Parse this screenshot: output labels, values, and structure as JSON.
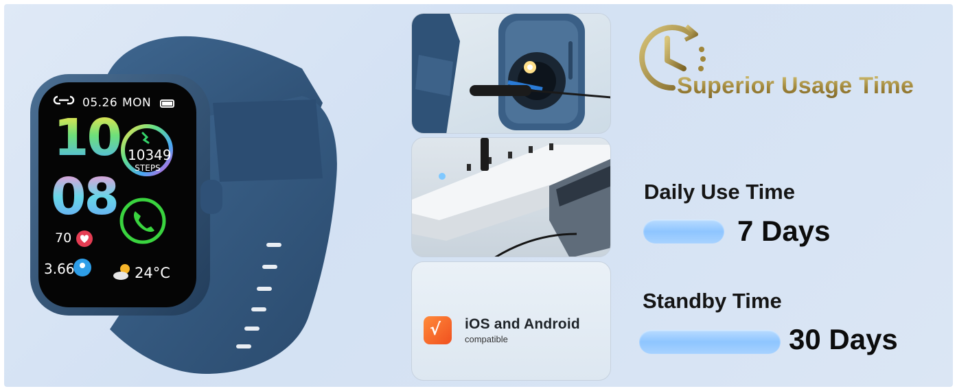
{
  "watch": {
    "date": "05.26",
    "day": "MON",
    "hour": "10",
    "minute": "08",
    "steps": "10349",
    "steps_label": "STEPS",
    "heart_rate": "70",
    "distance": "3.66",
    "temperature": "24°C",
    "colors": {
      "band": "#33577e",
      "screen": "#050505"
    }
  },
  "app": {
    "title": "iOS and Android",
    "subtitle": "compatible",
    "logo_color": "#f0501f"
  },
  "headline": "Superior Usage Time",
  "daily": {
    "label": "Daily Use Time",
    "value": "7 Days"
  },
  "standby": {
    "label": "Standby Time",
    "value": "30 Days"
  },
  "colors": {
    "gold": "#a0863a",
    "bar": "#8ec5ff",
    "background": "#d8e4f3"
  }
}
